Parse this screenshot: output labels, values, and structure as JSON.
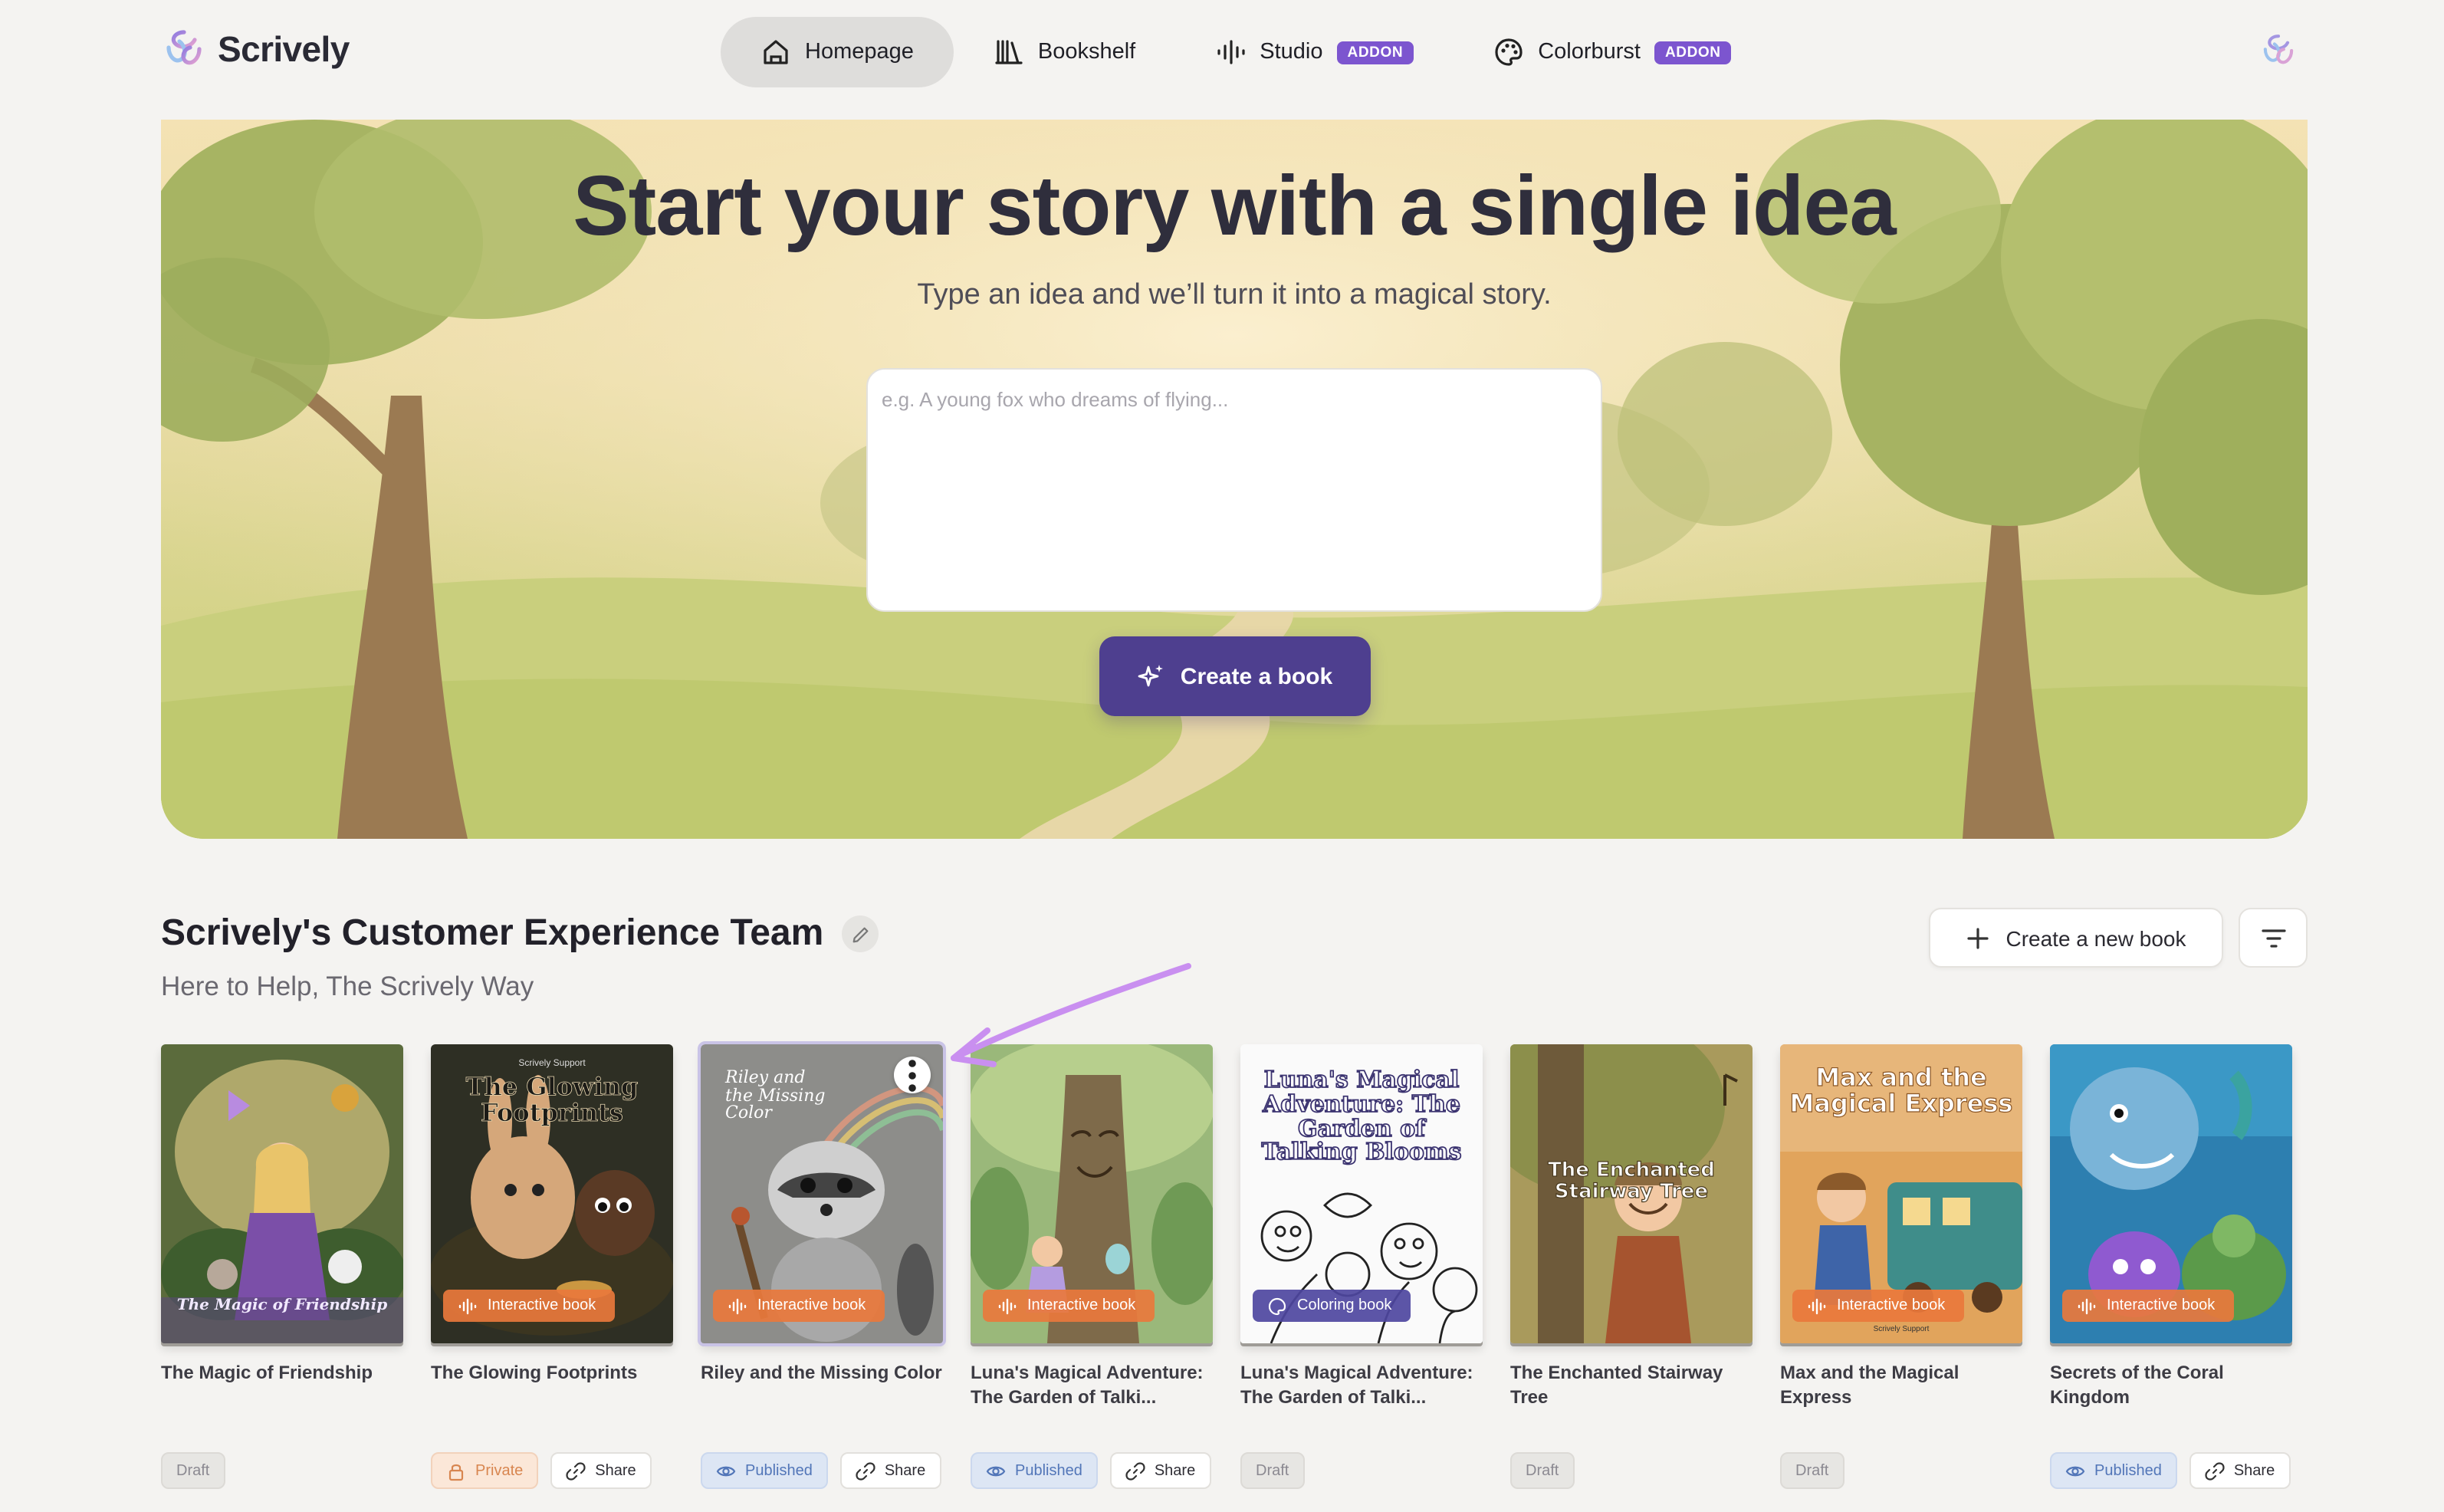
{
  "app": {
    "name": "Scrively",
    "colors": {
      "accent": "#4e3f8f",
      "addon": "#7c55cf",
      "interactive_badge": "#e9783c"
    }
  },
  "nav": {
    "items": [
      {
        "label": "Homepage",
        "icon": "home-icon",
        "active": true
      },
      {
        "label": "Bookshelf",
        "icon": "bookshelf-icon",
        "active": false
      },
      {
        "label": "Studio",
        "icon": "audio-waveform-icon",
        "badge": "ADDON",
        "active": false
      },
      {
        "label": "Colorburst",
        "icon": "palette-icon",
        "badge": "ADDON",
        "active": false
      }
    ]
  },
  "hero": {
    "title": "Start your story with a single idea",
    "subtitle": "Type an idea and we’ll turn it into a magical story.",
    "input_placeholder": "e.g. A young fox who dreams of flying...",
    "input_value": "",
    "button_label": "Create a book"
  },
  "team": {
    "name": "Scrively's Customer Experience Team",
    "tagline": "Here to Help, The Scrively Way",
    "new_book_label": "Create a new book"
  },
  "books": [
    {
      "title": "The Magic of Friendship",
      "cover_text": "The Magic of Friendship",
      "type": "",
      "status": "Draft",
      "share": ""
    },
    {
      "title": "The Glowing Footprints",
      "cover_text": "The Glowing Footprints",
      "cover_small": "Scrively Support",
      "type": "Interactive book",
      "status": "Private",
      "share": "Share"
    },
    {
      "title": "Riley and the Missing Color",
      "cover_text": "Riley and the Missing Color",
      "type": "Interactive book",
      "status": "Published",
      "share": "Share"
    },
    {
      "title": "Luna's Magical Adventure: The Garden of Talki...",
      "cover_text": "",
      "type": "Interactive book",
      "status": "Published",
      "share": "Share"
    },
    {
      "title": "Luna's Magical Adventure: The Garden of Talki...",
      "cover_text": "Luna's Magical Adventure: The Garden of Talking Blooms",
      "type": "Coloring book",
      "status": "Draft",
      "share": ""
    },
    {
      "title": "The Enchanted Stairway Tree",
      "cover_text": "The Enchanted Stairway Tree",
      "type": "",
      "status": "Draft",
      "share": ""
    },
    {
      "title": "Max and the Magical Express",
      "cover_text": "Max and the Magical Express",
      "cover_small": "Scrively Support",
      "type": "Interactive book",
      "status": "Draft",
      "share": ""
    },
    {
      "title": "Secrets of the Coral Kingdom",
      "cover_text": "",
      "type": "Interactive book",
      "status": "Published",
      "share": "Share"
    }
  ]
}
